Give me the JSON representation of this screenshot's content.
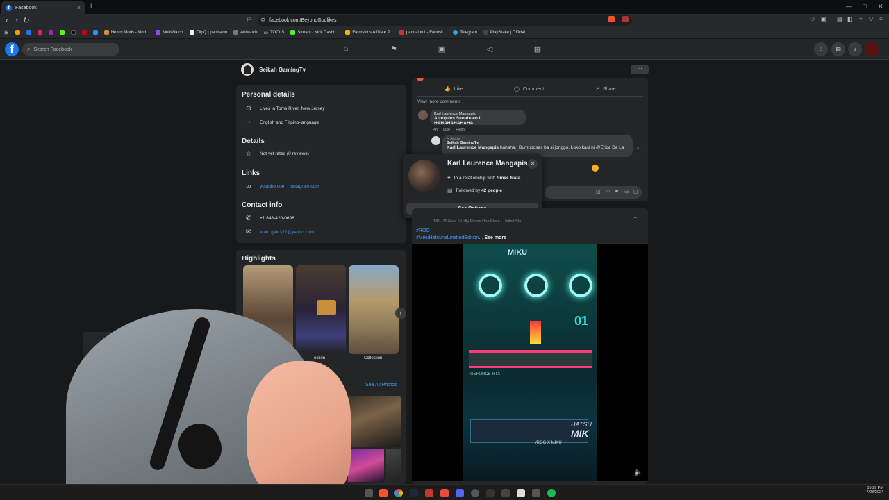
{
  "browser": {
    "tab_title": "Facebook",
    "tab_close": "×",
    "new_tab": "+",
    "url": "facebook.com/BeyondGodlikes",
    "bookmarks": [
      "Nexus Mods - Mod...",
      "MultiWatch",
      "ClipQ | pandaion",
      "Aniwatch",
      "TOOLS",
      "Stream - Kick Dashb...",
      "Farmskins Affiliate P...",
      "pandaion1 - Farmsk...",
      "Telegram",
      "PlayStake | Official..."
    ],
    "window_controls": [
      "—",
      "□",
      "✕"
    ]
  },
  "facebook": {
    "logo": "f",
    "search_placeholder": "Search Facebook"
  },
  "profile": {
    "name": "Seikah GamingTv",
    "more": "···"
  },
  "about": {
    "personal_title": "Personal details",
    "lives": "Lives in Toms River, New Jersey",
    "language": "English and Filipino-language",
    "details_title": "Details",
    "rating": "Not yet rated (0 reviews)",
    "links_title": "Links",
    "links": "youtube.com · instagram.com",
    "contact_title": "Contact info",
    "phone": "+1 848-420-0698",
    "email": "kram.gelo322@yahoo.com"
  },
  "highlights": {
    "title": "Highlights",
    "labels": [
      "ection",
      "Collection"
    ],
    "see_all_photos": "See All Photos"
  },
  "post1": {
    "like": "Like",
    "comment": "Comment",
    "share": "Share",
    "view_more": "View more comments",
    "c1_name": "Karl Laurence Mangapis",
    "c1_text": "Aronjules Senabuen ll HAHAHAHAHAHA",
    "c1_time": "4h",
    "c1_like": "Like",
    "c1_reply": "Reply",
    "r_badge": "Author",
    "r_name": "Seikah GamingTv",
    "r_mention": "Karl Laurence Mangapis",
    "r_text": " hahaha.! Bumuboses ba si jonggo. Loko kasi ni @Erica De La",
    "r_more": "···"
  },
  "hovercard": {
    "name": "Karl Laurence Mangapis",
    "close": "×",
    "relationship_pre": "In a relationship with ",
    "relationship_name": "Nince Mata",
    "followed_pre": "Followed by ",
    "followed_count": "42 people",
    "see_options": "See Options"
  },
  "post2": {
    "header_text": "TIP · 25 Gear 5 Luffy Phone One Piece · United Sta",
    "more": "···",
    "tag1": "#ROG",
    "tag2": "#MikuHatsuneLimittedEdition",
    "ellipsis": "...",
    "see_more": "See more",
    "video_text1": "MIKU",
    "video_text2": "GEFORCE RTX",
    "video_text3": "HATSU",
    "video_text4": "MIK",
    "video_text5": "/ROG X MIKU",
    "video_text6": "01",
    "mute": "🔈"
  },
  "taskbar": {
    "time": "10:29 PM",
    "date": "7/28/2024"
  },
  "colors": {
    "fb_blue": "#1877f2",
    "link": "#4599ff",
    "card": "#242526",
    "bg": "#18191a"
  }
}
